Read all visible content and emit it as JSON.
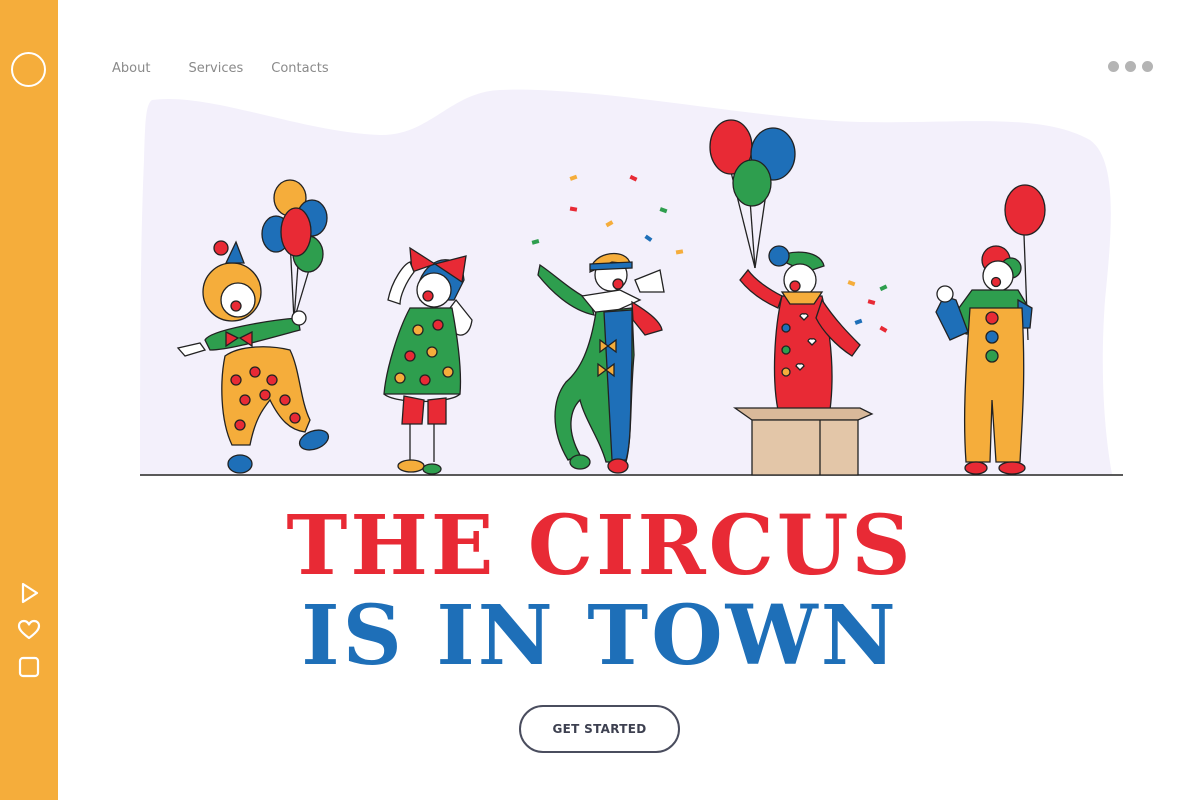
{
  "nav": {
    "items": [
      "About",
      "Services",
      "Contacts"
    ]
  },
  "hero": {
    "line1": "THE CIRCUS",
    "line2": "IS IN TOWN",
    "cta_label": "GET STARTED"
  },
  "icons": {
    "sidebar": [
      "circle-logo-icon",
      "play-icon",
      "heart-icon",
      "square-icon"
    ],
    "menu": "more-dots-icon"
  },
  "colors": {
    "sidebar": "#F5AD3B",
    "headline_red": "#E82A35",
    "headline_blue": "#1E6FB8",
    "backdrop": "#F3F0FB"
  }
}
